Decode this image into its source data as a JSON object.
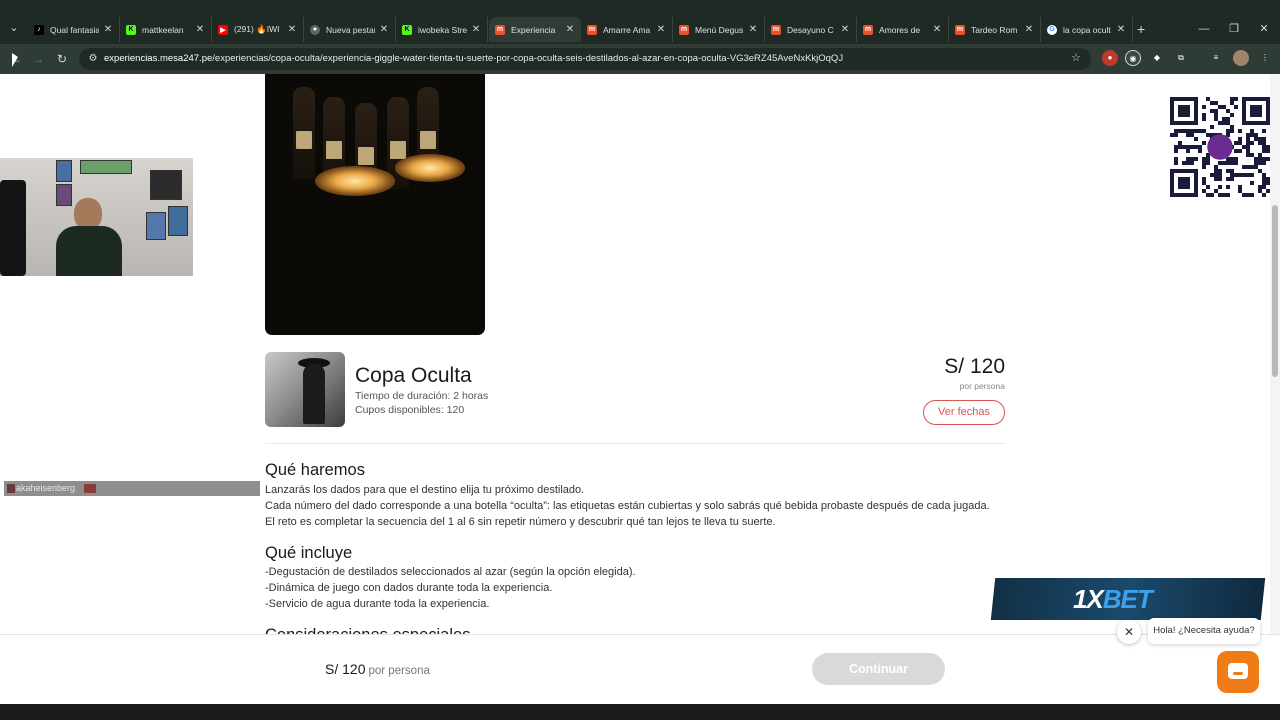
{
  "browser": {
    "tabs": [
      {
        "title": "Qual fantasia",
        "favicon": "tiktok-icon",
        "color": "#000000"
      },
      {
        "title": "mattkeelan",
        "favicon": "kick-icon",
        "color": "#53fc18"
      },
      {
        "title": "(291) 🔥IWI",
        "favicon": "youtube-icon",
        "color": "#ff0000"
      },
      {
        "title": "Nueva pestaña",
        "favicon": "chrome-icon",
        "color": "#5f6368"
      },
      {
        "title": "iwobeka Stre",
        "favicon": "kick-icon",
        "color": "#53fc18"
      },
      {
        "title": "Experiencia",
        "favicon": "mesa247-icon",
        "color": "#e8542f",
        "active": true
      },
      {
        "title": "Amarre Ama",
        "favicon": "mesa247-icon",
        "color": "#e8542f"
      },
      {
        "title": "Menú Degus",
        "favicon": "mesa247-icon",
        "color": "#e8542f"
      },
      {
        "title": "Desayuno C",
        "favicon": "mesa247-icon",
        "color": "#e8542f"
      },
      {
        "title": "Amores de",
        "favicon": "mesa247-icon",
        "color": "#e8542f"
      },
      {
        "title": "Tardeo Rom",
        "favicon": "mesa247-icon",
        "color": "#e8542f"
      },
      {
        "title": "la copa ocult",
        "favicon": "google-icon",
        "color": "#4285f4"
      }
    ],
    "url_host": "experiencias.mesa247.pe",
    "url_path": "/experiencias/copa-oculta/experiencia-giggle-water-tienta-tu-suerte-por-copa-oculta-seis-destilados-al-azar-en-copa-oculta-VG3eRZ45AveNxKkjOqQJ"
  },
  "experience": {
    "title": "Copa Oculta",
    "duration": "Tiempo de duración: 2 horas",
    "slots": "Cupos disponibles: 120",
    "price": "S/ 120",
    "price_unit": "por persona",
    "dates_button": "Ver fechas"
  },
  "sections": {
    "what_we_do": {
      "heading": "Qué haremos",
      "lines": [
        "Lanzarás los dados para que el destino elija tu próximo destilado.",
        "Cada número del dado corresponde a una botella “oculta”: las etiquetas están cubiertas y solo sabrás qué bebida probaste después de cada jugada.",
        "El reto es completar la secuencia del 1 al 6 sin repetir número y descubrir qué tan lejos te lleva tu suerte."
      ]
    },
    "includes": {
      "heading": "Qué incluye",
      "lines": [
        "-Degustación de destilados seleccionados al azar (según la opción elegida).",
        "-Dinámica de juego con dados durante toda la experiencia.",
        "-Servicio de agua durante toda la experiencia."
      ]
    },
    "considerations": {
      "heading": "Consideraciones especiales"
    }
  },
  "bottom_bar": {
    "price": "S/ 120",
    "price_unit": "por persona",
    "continue_button": "Continuar"
  },
  "overlays": {
    "username": "akaheisenberg",
    "chat_greeting": "Hola! ¿Necesita ayuda?",
    "ad_logo_main": "1X",
    "ad_logo_accent": "BET"
  }
}
